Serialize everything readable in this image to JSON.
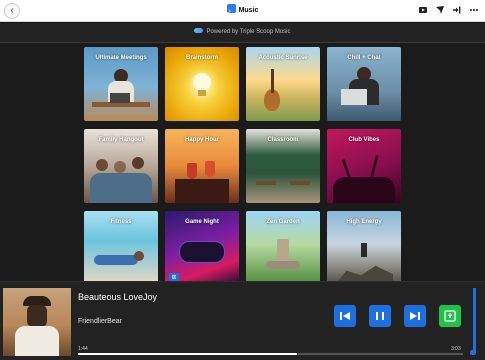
{
  "window": {
    "title": "Music",
    "back_glyph": "‹",
    "toolbar_icons": [
      "media-icon",
      "send-icon",
      "exit-icon",
      "more-icon"
    ]
  },
  "powered_by": "Powered by Triple Scoop Music",
  "tiles": [
    {
      "label": "Ultimate Meetings"
    },
    {
      "label": "Brainstorm"
    },
    {
      "label": "Acoustic Sunrise"
    },
    {
      "label": "Chill + Chat"
    },
    {
      "label": "Family Hangout"
    },
    {
      "label": "Happy Hour"
    },
    {
      "label": "Classroom"
    },
    {
      "label": "Club Vibes"
    },
    {
      "label": "Fitness"
    },
    {
      "label": "Game Night"
    },
    {
      "label": "Zen Garden"
    },
    {
      "label": "High Energy"
    }
  ],
  "player": {
    "track_title": "Beauteous LoveJoy",
    "artist": "FriendlierBear",
    "elapsed": "1:44",
    "duration": "3:03",
    "progress_fraction": 0.57,
    "volume_fraction": 1.0,
    "controls": [
      "previous-icon",
      "pause-icon",
      "next-icon",
      "share-icon"
    ],
    "accent_color": "#1e6fe0",
    "share_color": "#20c24a"
  }
}
